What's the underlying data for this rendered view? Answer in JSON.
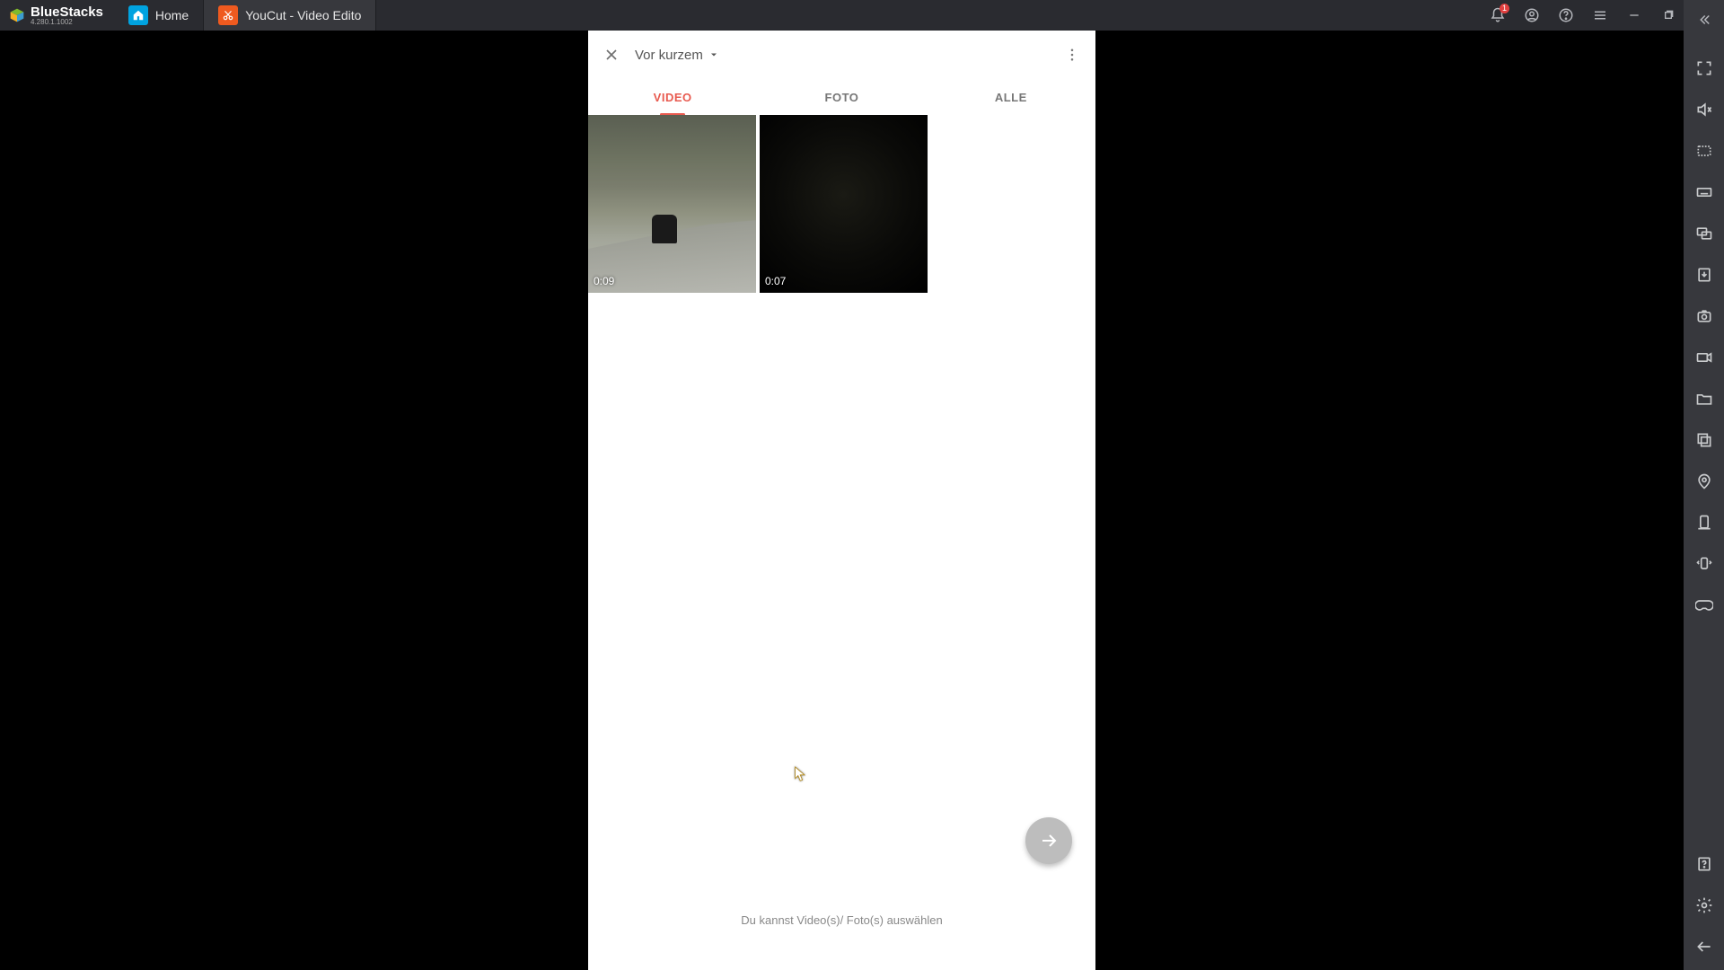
{
  "titlebar": {
    "brand": "BlueStacks",
    "version": "4.280.1.1002",
    "tabs": {
      "home": "Home",
      "app": "YouCut - Video Edito"
    },
    "notification_count": "1"
  },
  "picker": {
    "album_label": "Vor kurzem",
    "tabs": {
      "video": "VIDEO",
      "foto": "FOTO",
      "alle": "ALLE"
    },
    "items": [
      {
        "duration": "0:09"
      },
      {
        "duration": "0:07"
      }
    ],
    "hint": "Du kannst Video(s)/ Foto(s) auswählen"
  }
}
